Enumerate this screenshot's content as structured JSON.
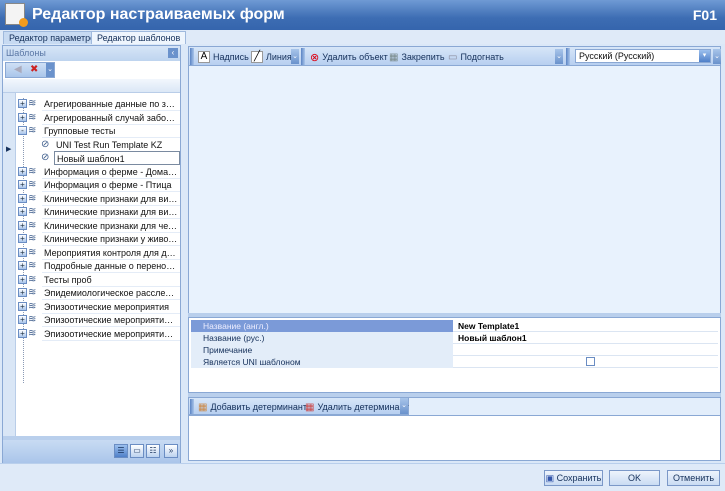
{
  "window": {
    "title": "Редактор настраиваемых форм",
    "code": "F01"
  },
  "tabs": [
    {
      "label": "Редактор параметров"
    },
    {
      "label": "Редактор шаблонов"
    }
  ],
  "left_panel": {
    "title": "Шаблоны",
    "tree": [
      {
        "label": "Агрегированные данные по заболе...",
        "level": 0,
        "expand": "+"
      },
      {
        "label": "Агрегированный случай заболеван...",
        "level": 0,
        "expand": "+"
      },
      {
        "label": "Групповые тесты",
        "level": 0,
        "expand": "-"
      },
      {
        "label": "UNI Test Run Template KZ",
        "level": 1
      },
      {
        "label": "Новый шаблон1",
        "level": 1,
        "selected": true
      },
      {
        "label": "Информация о ферме - Домашний ...",
        "level": 0,
        "expand": "+"
      },
      {
        "label": "Информация о ферме - Птица",
        "level": 0,
        "expand": "+"
      },
      {
        "label": "Клинические признаки для вида до...",
        "level": 0,
        "expand": "+"
      },
      {
        "label": "Клинические признаки для вида пт...",
        "level": 0,
        "expand": "+"
      },
      {
        "label": "Клинические признаки для человека",
        "level": 0,
        "expand": "+"
      },
      {
        "label": "Клинические признаки у животног...",
        "level": 0,
        "expand": "+"
      },
      {
        "label": "Мероприятия контроля для домаш...",
        "level": 0,
        "expand": "+"
      },
      {
        "label": "Подробные данные о переносчике",
        "level": 0,
        "expand": "+"
      },
      {
        "label": "Тесты проб",
        "level": 0,
        "expand": "+"
      },
      {
        "label": "Эпидемиологическое расследован...",
        "level": 0,
        "expand": "+"
      },
      {
        "label": "Эпизоотические мероприятия",
        "level": 0,
        "expand": "+"
      },
      {
        "label": "Эпизоотические мероприятия - ис...",
        "level": 0,
        "expand": "+"
      },
      {
        "label": "Эпизоотические мероприятия - ле...",
        "level": 0,
        "expand": "+"
      }
    ]
  },
  "toolbar": {
    "label_btn": "Надпись",
    "line_btn": "Линия",
    "delete_btn": "Удалить объект",
    "pin_btn": "Закрепить",
    "fit_btn": "Подогнать",
    "language": "Русский (Русский)"
  },
  "properties": [
    {
      "name": "Название (англ.)",
      "value": "New Template1"
    },
    {
      "name": "Название (рус.)",
      "value": "Новый шаблон1"
    },
    {
      "name": "Примечание",
      "value": ""
    },
    {
      "name": "Является UNI шаблоном",
      "value": "",
      "checked": false
    }
  ],
  "determinants": {
    "add_btn": "Добавить детерминант",
    "remove_btn": "Удалить детерминант"
  },
  "footer": {
    "save": "Сохранить",
    "ok": "OK",
    "cancel": "Отменить"
  }
}
